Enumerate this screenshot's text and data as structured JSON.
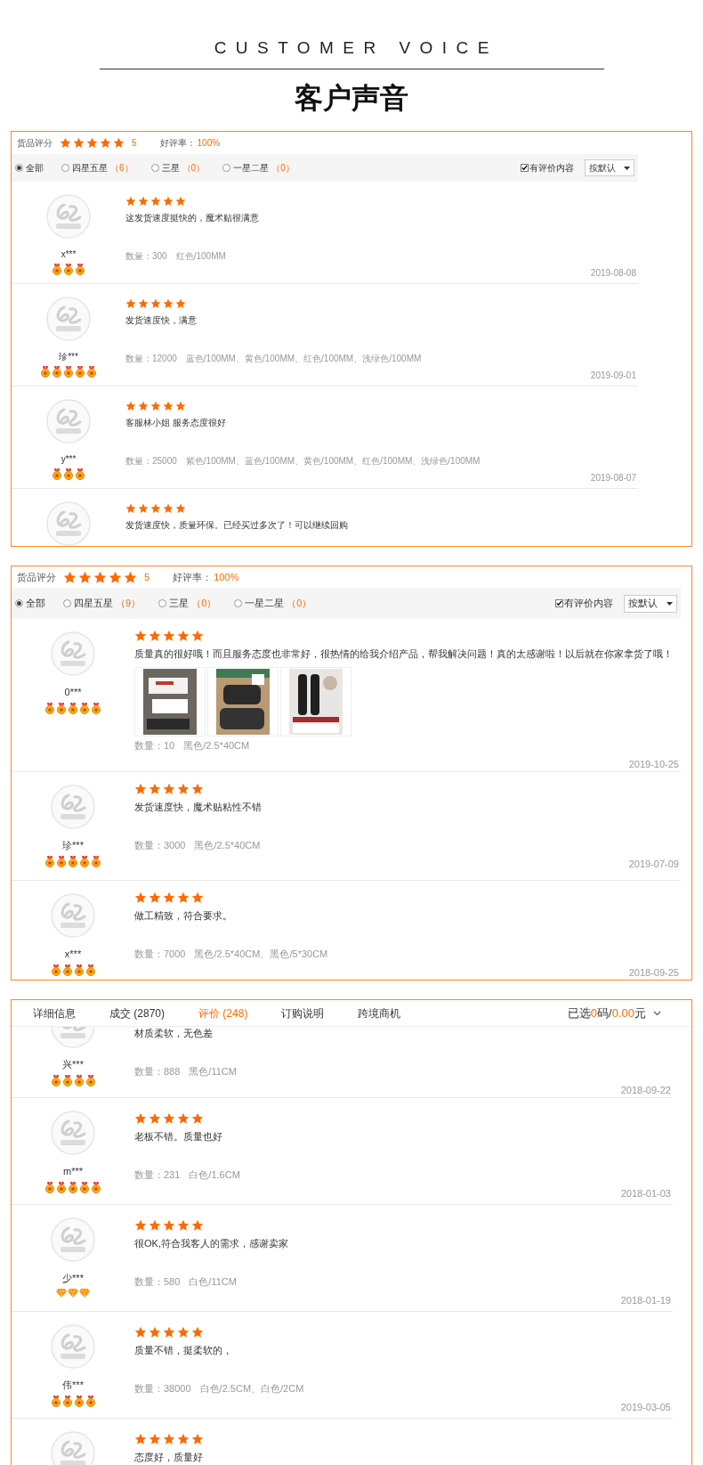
{
  "header": {
    "title_en": "CUSTOMER VOICE",
    "title": "客户声音"
  },
  "panels": [
    {
      "kind": "list",
      "summary": {
        "label": "货品评分",
        "stars": 5,
        "score": "5",
        "rate_label": "好评率：",
        "rate": "100%"
      },
      "filters": [
        {
          "label": "全部",
          "selected": true
        },
        {
          "label": "四星五星",
          "count": "（6）",
          "selected": false
        },
        {
          "label": "三星",
          "count": "（0）",
          "selected": false
        },
        {
          "label": "一星二星",
          "count": "（0）",
          "selected": false
        }
      ],
      "content_filter": {
        "label": "有评价内容",
        "checked": true
      },
      "sort": {
        "value": "按默认"
      },
      "reviews": [
        {
          "user": "x***",
          "badges": [
            {
              "kind": "medal"
            },
            {
              "kind": "medal"
            },
            {
              "kind": "medal"
            }
          ],
          "stars": 5,
          "text": "这发货速度挺快的，魔术贴很满意",
          "quantity": "数量：300",
          "specs": "红色/100MM",
          "date": "2019-08-08"
        },
        {
          "user": "珍***",
          "badges": [
            {
              "kind": "medal"
            },
            {
              "kind": "medal"
            },
            {
              "kind": "medal"
            },
            {
              "kind": "medal"
            },
            {
              "kind": "medal"
            }
          ],
          "stars": 5,
          "text": "发货速度快，满意",
          "quantity": "数量：12000",
          "specs": "蓝色/100MM、黄色/100MM、红色/100MM、浅绿色/100MM",
          "date": "2019-09-01"
        },
        {
          "user": "y***",
          "badges": [
            {
              "kind": "medal"
            },
            {
              "kind": "medal"
            },
            {
              "kind": "medal"
            }
          ],
          "stars": 5,
          "text": "客服林小姐 服务态度很好",
          "quantity": "数量：25000",
          "specs": "紫色/100MM、蓝色/100MM、黄色/100MM、红色/100MM、浅绿色/100MM",
          "date": "2019-08-07"
        },
        {
          "stars": 5,
          "text": "发货速度快，质量环保。已经买过多次了！可以继续回购"
        }
      ]
    },
    {
      "kind": "list",
      "summary": {
        "label": "货品评分",
        "stars": 5,
        "score": "5",
        "rate_label": "好评率：",
        "rate": "100%"
      },
      "filters": [
        {
          "label": "全部",
          "selected": true
        },
        {
          "label": "四星五星",
          "count": "（9）",
          "selected": false
        },
        {
          "label": "三星",
          "count": "（0）",
          "selected": false
        },
        {
          "label": "一星二星",
          "count": "（0）",
          "selected": false
        }
      ],
      "content_filter": {
        "label": "有评价内容",
        "checked": true
      },
      "sort": {
        "value": "按默认"
      },
      "reviews": [
        {
          "user": "0***",
          "badges": [
            {
              "kind": "medal"
            },
            {
              "kind": "medal"
            },
            {
              "kind": "medal"
            },
            {
              "kind": "medal"
            },
            {
              "kind": "medal"
            }
          ],
          "stars": 5,
          "text": "质量真的很好哦！而且服务态度也非常好，很热情的给我介绍产品，帮我解决问题！真的太感谢啦！以后就在你家拿货了哦！",
          "photos": [
            {
              "kind": "picture"
            },
            {
              "kind": "picture"
            },
            {
              "kind": "picture"
            }
          ],
          "quantity": "数量：10",
          "specs": "黑色/2.5*40CM",
          "date": "2019-10-25"
        },
        {
          "user": "珍***",
          "badges": [
            {
              "kind": "medal"
            },
            {
              "kind": "medal"
            },
            {
              "kind": "medal"
            },
            {
              "kind": "medal"
            },
            {
              "kind": "medal"
            }
          ],
          "stars": 5,
          "text": "发货速度快，魔术贴粘性不错",
          "quantity": "数量：3000",
          "specs": "黑色/2.5*40CM",
          "date": "2019-07-09"
        },
        {
          "user": "x***",
          "badges": [
            {
              "kind": "medal"
            },
            {
              "kind": "medal"
            },
            {
              "kind": "medal"
            },
            {
              "kind": "medal"
            }
          ],
          "stars": 5,
          "text": "做工精致，符合要求。",
          "quantity": "数量：7000",
          "specs": "黑色/2.5*40CM、黑色/5*30CM",
          "date": "2018-09-25"
        }
      ]
    },
    {
      "kind": "tabbed",
      "tabs": [
        {
          "label": "详细信息",
          "selected": false
        },
        {
          "label": "成交 (2870)",
          "selected": false
        },
        {
          "label": "评价 (248)",
          "selected": true
        },
        {
          "label": "订购说明",
          "selected": false
        },
        {
          "label": "跨境商机",
          "selected": false
        }
      ],
      "cart": {
        "prefix": "已选",
        "count": "0",
        "unit": "码/",
        "amount": "0.00",
        "currency": "元"
      },
      "reviews": [
        {
          "user": "兴***",
          "badges": [
            {
              "kind": "medal"
            },
            {
              "kind": "medal"
            },
            {
              "kind": "medal"
            },
            {
              "kind": "medal"
            }
          ],
          "text": "材质柔软，无色差",
          "quantity": "数量：888",
          "specs": "黑色/11CM",
          "date": "2018-09-22"
        },
        {
          "user": "m***",
          "badges": [
            {
              "kind": "medal"
            },
            {
              "kind": "medal"
            },
            {
              "kind": "medal"
            },
            {
              "kind": "medal"
            },
            {
              "kind": "medal"
            }
          ],
          "stars": 5,
          "text": "老板不错。质量也好",
          "quantity": "数量：231",
          "specs": "白色/1.6CM",
          "date": "2018-01-03"
        },
        {
          "user": "少***",
          "badges": [
            {
              "kind": "diamond"
            },
            {
              "kind": "diamond"
            },
            {
              "kind": "diamond"
            }
          ],
          "stars": 5,
          "text": "很OK,符合我客人的需求，感谢卖家",
          "quantity": "数量：580",
          "specs": "白色/11CM",
          "date": "2018-01-19"
        },
        {
          "user": "伟***",
          "badges": [
            {
              "kind": "medal"
            },
            {
              "kind": "medal"
            },
            {
              "kind": "medal"
            },
            {
              "kind": "medal"
            }
          ],
          "stars": 5,
          "text": "质量不错，挺柔软的，",
          "quantity": "数量：38000",
          "specs": "白色/2.5CM、白色/2CM",
          "date": "2019-03-05"
        },
        {
          "stars": 5,
          "text": "态度好，质量好"
        }
      ]
    }
  ]
}
